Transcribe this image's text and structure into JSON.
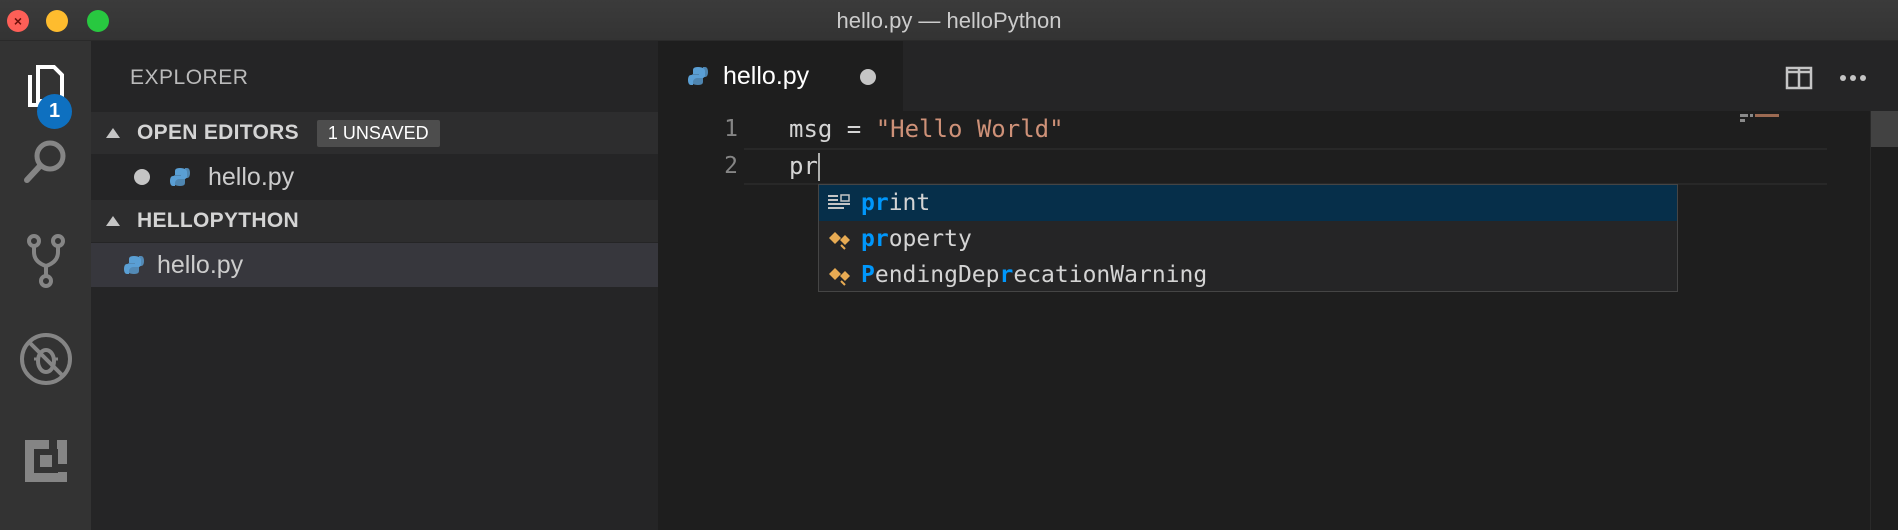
{
  "window": {
    "title": "hello.py — helloPython",
    "controls": [
      "close",
      "minimize",
      "maximize"
    ]
  },
  "activity_bar": {
    "items": [
      {
        "name": "explorer",
        "icon": "files-icon",
        "badge": "1"
      },
      {
        "name": "search",
        "icon": "search-icon"
      },
      {
        "name": "source-control",
        "icon": "source-control-icon"
      },
      {
        "name": "debug",
        "icon": "debug-icon"
      },
      {
        "name": "extensions",
        "icon": "extensions-icon"
      }
    ]
  },
  "sidebar": {
    "title": "EXPLORER",
    "open_editors": {
      "label": "OPEN EDITORS",
      "badge": "1 UNSAVED",
      "files": [
        {
          "name": "hello.py",
          "unsaved": true,
          "icon": "python-icon"
        }
      ]
    },
    "workspace": {
      "label": "HELLOPYTHON",
      "files": [
        {
          "name": "hello.py",
          "icon": "python-icon"
        }
      ]
    }
  },
  "editor": {
    "tab": {
      "label": "hello.py",
      "icon": "python-icon",
      "dirty": true
    },
    "actions": [
      {
        "name": "split-editor",
        "icon": "split-editor-icon"
      },
      {
        "name": "more-actions",
        "icon": "ellipsis-icon"
      }
    ],
    "lines": [
      {
        "number": "1",
        "tokens": [
          {
            "text": "msg = ",
            "kind": "plain"
          },
          {
            "text": "\"Hello World\"",
            "kind": "string"
          }
        ]
      },
      {
        "number": "2",
        "tokens": [
          {
            "text": "pr",
            "kind": "plain"
          }
        ]
      }
    ],
    "suggestions": [
      {
        "match": "pr",
        "rest": "int",
        "icon": "snippet-icon",
        "focused": true
      },
      {
        "match": "pr",
        "rest": "operty",
        "icon": "class-icon",
        "focused": false
      },
      {
        "segments": [
          "P",
          "endingDep",
          "r",
          "ecationWarning"
        ],
        "icon": "class-icon",
        "focused": false
      }
    ],
    "colors": {
      "string": "#ce9178",
      "match_highlight": "#0097fb",
      "focused_suggestion": "#062f4a",
      "badge": "#0e70c0"
    }
  }
}
